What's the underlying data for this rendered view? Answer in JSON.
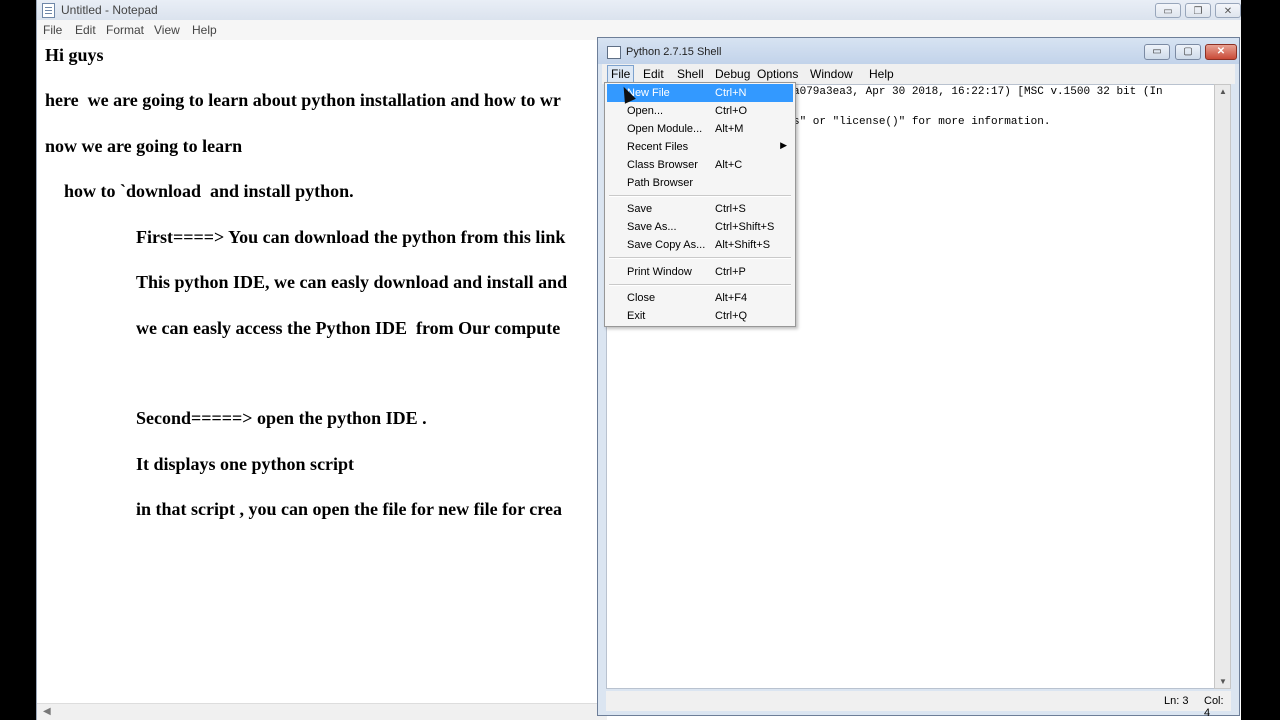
{
  "notepad": {
    "title": "Untitled - Notepad",
    "controls": {
      "minimize": "▭",
      "maximize": "❐",
      "close": "✕"
    },
    "menu": [
      "File",
      "Edit",
      "Format",
      "View",
      "Help"
    ],
    "lines": [
      "Hi guys",
      "here  we are going to learn about python installation and how to wr",
      "now we are going to learn",
      "how to `download  and install python.",
      "First====> You can download the python from this link",
      "This python IDE, we can easly download and install and",
      "we can easly access the Python IDE  from Our compute",
      "Second=====> open the python IDE .",
      "It displays one python script",
      "in that script , you can open the file for new file for crea"
    ]
  },
  "shell": {
    "title": "Python 2.7.15 Shell",
    "controls": {
      "minimize": "▭",
      "maximize": "▢",
      "close": "✕"
    },
    "menu": [
      "File",
      "Edit",
      "Shell",
      "Debug",
      "Options",
      "Window",
      "Help"
    ],
    "lines": [
      "a079a3ea3, Apr 30 2018, 16:22:17) [MSC v.1500 32 bit (In",
      "s\" or \"license()\" for more information."
    ],
    "status": {
      "ln": "Ln: 3",
      "col": "Col: 4"
    }
  },
  "file_menu": {
    "items": [
      {
        "label": "New File",
        "accel": "Ctrl+N"
      },
      {
        "label": "Open...",
        "accel": "Ctrl+O"
      },
      {
        "label": "Open Module...",
        "accel": "Alt+M"
      },
      {
        "label": "Recent Files",
        "accel": ""
      },
      {
        "label": "Class Browser",
        "accel": "Alt+C"
      },
      {
        "label": "Path Browser",
        "accel": ""
      },
      {
        "label": "Save",
        "accel": "Ctrl+S"
      },
      {
        "label": "Save As...",
        "accel": "Ctrl+Shift+S"
      },
      {
        "label": "Save Copy As...",
        "accel": "Alt+Shift+S"
      },
      {
        "label": "Print Window",
        "accel": "Ctrl+P"
      },
      {
        "label": "Close",
        "accel": "Alt+F4"
      },
      {
        "label": "Exit",
        "accel": "Ctrl+Q"
      }
    ],
    "submenu_arrow": "▶"
  }
}
